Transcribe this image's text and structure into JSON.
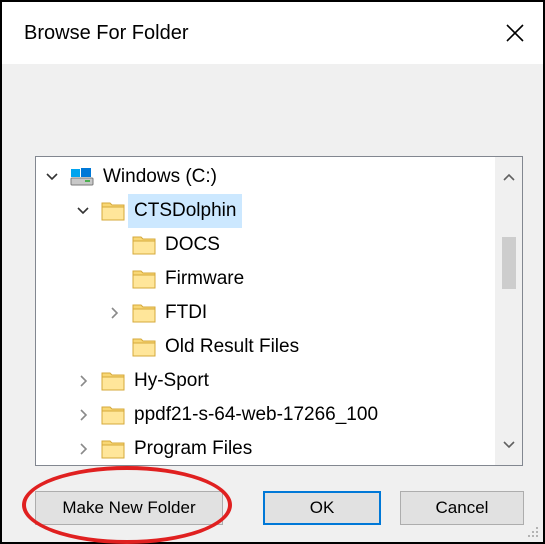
{
  "dialog": {
    "title": "Browse For Folder"
  },
  "tree": {
    "rows": [
      {
        "label": "Windows (C:)",
        "icon": "drive-icon",
        "expander": "expanded",
        "selected": false
      },
      {
        "label": "CTSDolphin",
        "icon": "folder-icon",
        "expander": "expanded",
        "selected": true
      },
      {
        "label": "DOCS",
        "icon": "folder-icon",
        "expander": "none",
        "selected": false
      },
      {
        "label": "Firmware",
        "icon": "folder-icon",
        "expander": "none",
        "selected": false
      },
      {
        "label": "FTDI",
        "icon": "folder-icon",
        "expander": "collapsed",
        "selected": false
      },
      {
        "label": "Old Result Files",
        "icon": "folder-icon",
        "expander": "none",
        "selected": false
      },
      {
        "label": "Hy-Sport",
        "icon": "folder-icon",
        "expander": "collapsed",
        "selected": false
      },
      {
        "label": "ppdf21-s-64-web-17266_100",
        "icon": "folder-icon",
        "expander": "collapsed",
        "selected": false
      },
      {
        "label": "Program Files",
        "icon": "folder-icon",
        "expander": "collapsed",
        "selected": false
      }
    ]
  },
  "buttons": {
    "make_new_folder": "Make New Folder",
    "ok": "OK",
    "cancel": "Cancel"
  },
  "colors": {
    "selection": "#cce8ff",
    "folder": "#f8d775",
    "accent_border": "#0078d7",
    "annotation": "#e02020"
  }
}
